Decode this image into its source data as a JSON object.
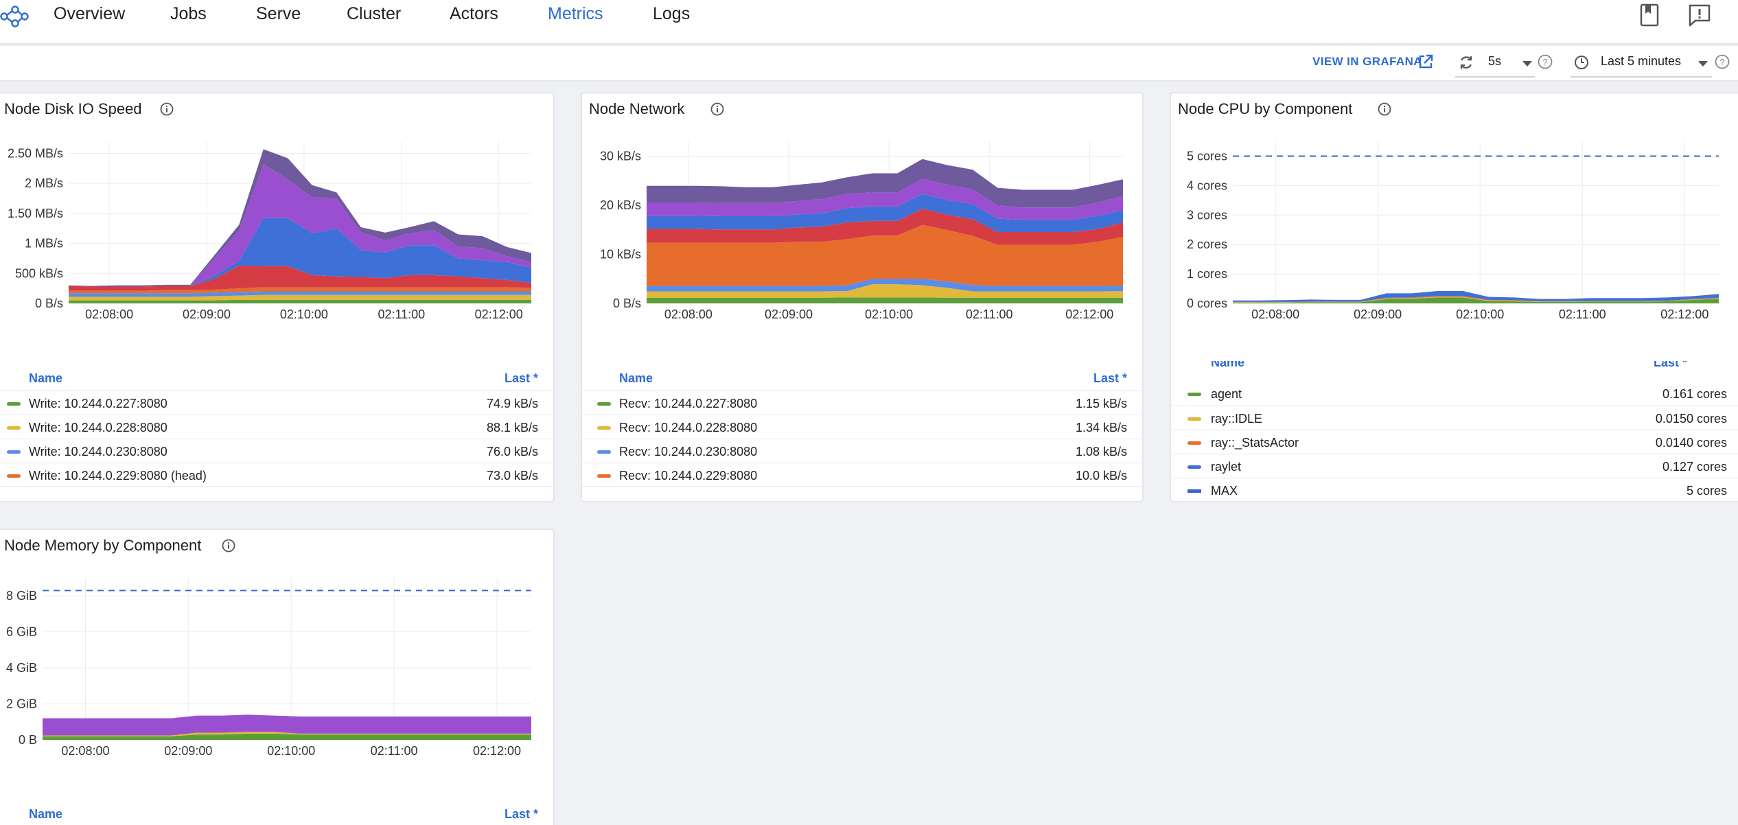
{
  "nav": {
    "items": [
      {
        "label": "Overview",
        "active": false
      },
      {
        "label": "Jobs",
        "active": false
      },
      {
        "label": "Serve",
        "active": false
      },
      {
        "label": "Cluster",
        "active": false
      },
      {
        "label": "Actors",
        "active": false
      },
      {
        "label": "Metrics",
        "active": true
      },
      {
        "label": "Logs",
        "active": false
      }
    ],
    "icons": [
      "docs-book-icon",
      "feedback-icon"
    ]
  },
  "toolbar": {
    "grafana_label": "VIEW IN GRAFANA",
    "refresh_value": "5s",
    "time_range_value": "Last 5 minutes"
  },
  "colors": {
    "accent": "#2e6bd1",
    "series": [
      "#5c9e3b",
      "#e0b93a",
      "#5b8ce8",
      "#e66d2c",
      "#d63c43",
      "#3f70d8",
      "#9a4fd1",
      "#6e5a9c"
    ]
  },
  "panels": {
    "disk": {
      "title": "Node Disk IO Speed",
      "legend_name": "Name",
      "legend_last": "Last *",
      "legend": [
        {
          "name": "Write: 10.244.0.227:8080",
          "value": "74.9 kB/s"
        },
        {
          "name": "Write: 10.244.0.228:8080",
          "value": "88.1 kB/s"
        },
        {
          "name": "Write: 10.244.0.230:8080",
          "value": "76.0 kB/s"
        },
        {
          "name": "Write: 10.244.0.229:8080 (head)",
          "value": "73.0 kB/s"
        }
      ]
    },
    "network": {
      "title": "Node Network",
      "legend_name": "Name",
      "legend_last": "Last *",
      "legend": [
        {
          "name": "Recv: 10.244.0.227:8080",
          "value": "1.15 kB/s"
        },
        {
          "name": "Recv: 10.244.0.228:8080",
          "value": "1.34 kB/s"
        },
        {
          "name": "Recv: 10.244.0.230:8080",
          "value": "1.08 kB/s"
        },
        {
          "name": "Recv: 10.244.0.229:8080",
          "value": "10.0 kB/s"
        }
      ]
    },
    "cpu": {
      "title": "Node CPU by Component",
      "legend_name": "Name",
      "legend_last": "Last *",
      "legend": [
        {
          "name": "agent",
          "value": "0.161 cores"
        },
        {
          "name": "ray::IDLE",
          "value": "0.0150 cores"
        },
        {
          "name": "ray::_StatsActor",
          "value": "0.0140 cores"
        },
        {
          "name": "raylet",
          "value": "0.127 cores"
        },
        {
          "name": "MAX",
          "value": "5 cores"
        }
      ]
    },
    "memory": {
      "title": "Node Memory by Component",
      "legend_name": "Name",
      "legend_last": "Last *"
    }
  },
  "chart_data": [
    {
      "type": "area",
      "stacked": true,
      "x": [
        "02:07:35",
        "02:07:50",
        "02:08:05",
        "02:08:20",
        "02:08:35",
        "02:08:50",
        "02:09:05",
        "02:09:20",
        "02:09:35",
        "02:09:50",
        "02:10:05",
        "02:10:20",
        "02:10:35",
        "02:10:50",
        "02:11:05",
        "02:11:20",
        "02:11:35",
        "02:11:50",
        "02:12:05",
        "02:12:20"
      ],
      "x_ticks": [
        "02:08:00",
        "02:09:00",
        "02:10:00",
        "02:11:00",
        "02:12:00"
      ],
      "y_ticks": [
        "0 B/s",
        "500 kB/s",
        "1 MB/s",
        "1.50 MB/s",
        "2 MB/s",
        "2.50 MB/s"
      ],
      "ylim": [
        0,
        2.7
      ],
      "grid": true,
      "legend_position": "bottom",
      "series": [
        {
          "values": [
            0.05,
            0.05,
            0.05,
            0.05,
            0.05,
            0.05,
            0.05,
            0.06,
            0.06,
            0.06,
            0.06,
            0.06,
            0.06,
            0.06,
            0.06,
            0.06,
            0.06,
            0.06,
            0.06,
            0.06
          ]
        },
        {
          "values": [
            0.06,
            0.06,
            0.06,
            0.06,
            0.06,
            0.06,
            0.07,
            0.07,
            0.08,
            0.08,
            0.08,
            0.08,
            0.08,
            0.08,
            0.08,
            0.08,
            0.08,
            0.08,
            0.08,
            0.08
          ]
        },
        {
          "values": [
            0.06,
            0.06,
            0.06,
            0.06,
            0.06,
            0.06,
            0.06,
            0.06,
            0.06,
            0.06,
            0.06,
            0.06,
            0.06,
            0.06,
            0.06,
            0.06,
            0.06,
            0.06,
            0.06,
            0.06
          ]
        },
        {
          "values": [
            0.04,
            0.04,
            0.04,
            0.04,
            0.05,
            0.05,
            0.05,
            0.06,
            0.07,
            0.07,
            0.07,
            0.07,
            0.07,
            0.07,
            0.07,
            0.07,
            0.07,
            0.07,
            0.07,
            0.06
          ]
        },
        {
          "values": [
            0.08,
            0.07,
            0.07,
            0.07,
            0.07,
            0.07,
            0.18,
            0.38,
            0.35,
            0.35,
            0.2,
            0.18,
            0.17,
            0.15,
            0.2,
            0.2,
            0.18,
            0.15,
            0.12,
            0.08
          ]
        },
        {
          "values": [
            0,
            0,
            0,
            0,
            0,
            0,
            0.05,
            0.08,
            0.8,
            0.8,
            0.7,
            0.8,
            0.45,
            0.43,
            0.5,
            0.5,
            0.3,
            0.3,
            0.3,
            0.25
          ]
        },
        {
          "values": [
            0,
            0,
            0,
            0,
            0,
            0,
            0.3,
            0.5,
            0.9,
            0.65,
            0.6,
            0.5,
            0.3,
            0.2,
            0.2,
            0.25,
            0.2,
            0.2,
            0.1,
            0.1
          ]
        },
        {
          "values": [
            0.01,
            0.01,
            0.02,
            0.02,
            0.02,
            0.02,
            0.05,
            0.1,
            0.25,
            0.35,
            0.2,
            0.1,
            0.08,
            0.13,
            0.1,
            0.15,
            0.2,
            0.2,
            0.15,
            0.15
          ]
        }
      ]
    },
    {
      "type": "area",
      "stacked": true,
      "x": [
        "02:07:35",
        "02:07:50",
        "02:08:05",
        "02:08:20",
        "02:08:35",
        "02:08:50",
        "02:09:05",
        "02:09:20",
        "02:09:35",
        "02:09:50",
        "02:10:05",
        "02:10:20",
        "02:10:35",
        "02:10:50",
        "02:11:05",
        "02:11:20",
        "02:11:35",
        "02:11:50",
        "02:12:05",
        "02:12:20"
      ],
      "x_ticks": [
        "02:08:00",
        "02:09:00",
        "02:10:00",
        "02:11:00",
        "02:12:00"
      ],
      "y_ticks": [
        "0 B/s",
        "10 kB/s",
        "20 kB/s",
        "30 kB/s"
      ],
      "ylim": [
        0,
        33
      ],
      "grid": true,
      "legend_position": "bottom",
      "series": [
        {
          "values": [
            1.15,
            1.15,
            1.15,
            1.15,
            1.15,
            1.15,
            1.15,
            1.15,
            1.2,
            1.2,
            1.2,
            1.2,
            1.15,
            1.15,
            1.15,
            1.15,
            1.15,
            1.15,
            1.15,
            1.15
          ]
        },
        {
          "values": [
            1.3,
            1.3,
            1.3,
            1.3,
            1.3,
            1.3,
            1.3,
            1.3,
            1.3,
            2.7,
            2.7,
            2.5,
            2.0,
            1.3,
            1.3,
            1.3,
            1.3,
            1.3,
            1.3,
            1.34
          ]
        },
        {
          "values": [
            1.1,
            1.1,
            1.1,
            1.1,
            1.1,
            1.1,
            1.1,
            1.1,
            1.2,
            1.1,
            1.1,
            1.3,
            1.3,
            1.3,
            1.1,
            1.1,
            1.1,
            1.1,
            1.1,
            1.08
          ]
        },
        {
          "values": [
            8.8,
            8.8,
            8.8,
            8.8,
            8.8,
            8.8,
            9.0,
            9.0,
            9.4,
            8.8,
            8.8,
            11.0,
            10.5,
            10.0,
            8.4,
            8.4,
            8.4,
            8.4,
            9.0,
            10.0
          ]
        },
        {
          "values": [
            2.8,
            2.8,
            2.8,
            2.7,
            2.7,
            2.7,
            2.9,
            3.1,
            3.4,
            3.0,
            3.0,
            3.3,
            3.1,
            3.4,
            2.6,
            2.6,
            2.6,
            2.6,
            2.6,
            2.9
          ]
        },
        {
          "values": [
            2.7,
            2.7,
            2.7,
            2.7,
            2.7,
            2.7,
            2.7,
            2.7,
            2.9,
            2.9,
            2.9,
            3.0,
            3.0,
            3.1,
            2.7,
            2.5,
            2.5,
            2.5,
            2.7,
            2.5
          ]
        },
        {
          "values": [
            2.7,
            2.7,
            2.7,
            2.7,
            2.7,
            2.7,
            2.7,
            2.9,
            2.9,
            2.9,
            2.9,
            3.1,
            3.1,
            3.0,
            2.7,
            2.5,
            2.5,
            2.5,
            2.7,
            2.8
          ]
        },
        {
          "values": [
            3.4,
            3.4,
            3.4,
            3.4,
            3.2,
            3.2,
            3.3,
            3.4,
            3.4,
            3.9,
            3.9,
            4.0,
            4.0,
            4.0,
            3.6,
            3.6,
            3.6,
            3.6,
            3.6,
            3.5
          ]
        }
      ]
    },
    {
      "type": "area",
      "stacked": true,
      "x": [
        "02:07:35",
        "02:07:50",
        "02:08:05",
        "02:08:20",
        "02:08:35",
        "02:08:50",
        "02:09:05",
        "02:09:20",
        "02:09:35",
        "02:09:50",
        "02:10:05",
        "02:10:20",
        "02:10:35",
        "02:10:50",
        "02:11:05",
        "02:11:20",
        "02:11:35",
        "02:11:50",
        "02:12:05",
        "02:12:20"
      ],
      "x_ticks": [
        "02:08:00",
        "02:09:00",
        "02:10:00",
        "02:11:00",
        "02:12:00"
      ],
      "y_ticks": [
        "0 cores",
        "1 cores",
        "2 cores",
        "3 cores",
        "4 cores",
        "5 cores"
      ],
      "ylim": [
        0,
        5.5
      ],
      "grid": true,
      "legend_position": "bottom",
      "max_line": 5,
      "series": [
        {
          "values": [
            0.03,
            0.03,
            0.03,
            0.04,
            0.04,
            0.04,
            0.15,
            0.16,
            0.2,
            0.2,
            0.08,
            0.07,
            0.05,
            0.05,
            0.06,
            0.06,
            0.06,
            0.07,
            0.12,
            0.161
          ]
        },
        {
          "values": [
            0.01,
            0.01,
            0.01,
            0.01,
            0.01,
            0.01,
            0.02,
            0.02,
            0.02,
            0.02,
            0.02,
            0.02,
            0.01,
            0.01,
            0.01,
            0.01,
            0.01,
            0.01,
            0.015,
            0.015
          ]
        },
        {
          "values": [
            0.01,
            0.01,
            0.01,
            0.01,
            0.01,
            0.01,
            0.02,
            0.02,
            0.03,
            0.03,
            0.02,
            0.02,
            0.01,
            0.01,
            0.01,
            0.01,
            0.01,
            0.01,
            0.014,
            0.014
          ]
        },
        {
          "values": [
            0.05,
            0.05,
            0.06,
            0.07,
            0.06,
            0.06,
            0.15,
            0.14,
            0.17,
            0.17,
            0.1,
            0.09,
            0.08,
            0.08,
            0.1,
            0.1,
            0.1,
            0.11,
            0.1,
            0.127
          ]
        }
      ]
    },
    {
      "type": "area",
      "stacked": true,
      "x": [
        "02:07:35",
        "02:07:50",
        "02:08:05",
        "02:08:20",
        "02:08:35",
        "02:08:50",
        "02:09:05",
        "02:09:20",
        "02:09:35",
        "02:09:50",
        "02:10:05",
        "02:10:20",
        "02:10:35",
        "02:10:50",
        "02:11:05",
        "02:11:20",
        "02:11:35",
        "02:11:50",
        "02:12:05",
        "02:12:20"
      ],
      "x_ticks": [
        "02:08:00",
        "02:09:00",
        "02:10:00",
        "02:11:00",
        "02:12:00"
      ],
      "y_ticks": [
        "0 B",
        "2 GiB",
        "4 GiB",
        "6 GiB",
        "8 GiB"
      ],
      "ylim": [
        0,
        9
      ],
      "grid": true,
      "legend_position": "bottom",
      "max_line": 8.3,
      "series": [
        {
          "values": [
            0.2,
            0.2,
            0.2,
            0.2,
            0.2,
            0.2,
            0.3,
            0.3,
            0.35,
            0.35,
            0.3,
            0.3,
            0.3,
            0.3,
            0.3,
            0.3,
            0.3,
            0.3,
            0.3,
            0.3
          ]
        },
        {
          "values": [
            0.05,
            0.05,
            0.05,
            0.05,
            0.05,
            0.05,
            0.1,
            0.1,
            0.1,
            0.1,
            0.05,
            0.05,
            0.05,
            0.05,
            0.05,
            0.05,
            0.05,
            0.05,
            0.05,
            0.05
          ]
        },
        {
          "values": [
            0.95,
            0.95,
            0.95,
            0.95,
            0.95,
            0.95,
            0.95,
            0.95,
            0.95,
            0.9,
            0.95,
            0.95,
            0.95,
            0.95,
            0.95,
            0.95,
            0.95,
            0.95,
            0.95,
            0.95
          ]
        }
      ]
    }
  ]
}
